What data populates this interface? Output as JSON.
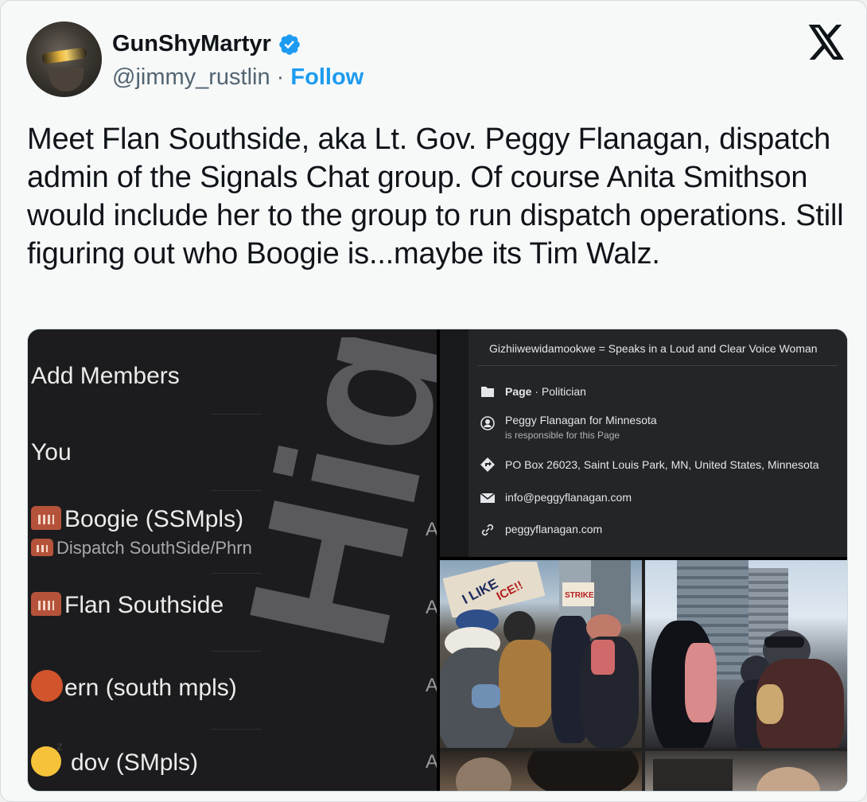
{
  "user": {
    "display_name": "GunShyMartyr",
    "handle": "@jimmy_rustlin",
    "separator": " · ",
    "follow_label": "Follow"
  },
  "tweet": {
    "text": "Meet Flan Southside, aka Lt. Gov. Peggy Flanagan, dispatch admin of the Signals Chat group. Of course Anita Smithson would include her to the group to run dispatch operations. Still figuring out who Boogie is...maybe its Tim Walz."
  },
  "media": {
    "chat": {
      "add_members": "Add Members",
      "you": "You",
      "members": [
        {
          "label": "Boogie (SSMpls)",
          "sub": "Dispatch SouthSide/Phrn",
          "icon": "phone-emoji-icon"
        },
        {
          "label": "Flan Southside",
          "icon": "phone-emoji-icon"
        },
        {
          "label": "ern (south mpls)",
          "icon": "red-circle-icon"
        },
        {
          "label": "dov (SMpls)",
          "icon": "sleeping-emoji-icon"
        }
      ],
      "trailing": "A",
      "watermark": "High"
    },
    "profile": {
      "title": "Gizhiiwewidamookwe = Speaks in a Loud and Clear Voice Woman",
      "page_bold": "Page",
      "page_type": " · Politician",
      "owner": "Peggy Flanagan for Minnesota",
      "owner_sub": "is responsible for this Page",
      "address": "PO Box 26023, Saint Louis Park, MN, United States, Minnesota",
      "email": "info@peggyflanagan.com",
      "website": "peggyflanagan.com"
    },
    "protest_signs": [
      "I LIKE",
      "ICE!!",
      "STRIKE"
    ]
  },
  "colors": {
    "follow": "#1d9bf0",
    "verified": "#1d9bf0",
    "text": "#0f1419",
    "muted": "#536471"
  }
}
